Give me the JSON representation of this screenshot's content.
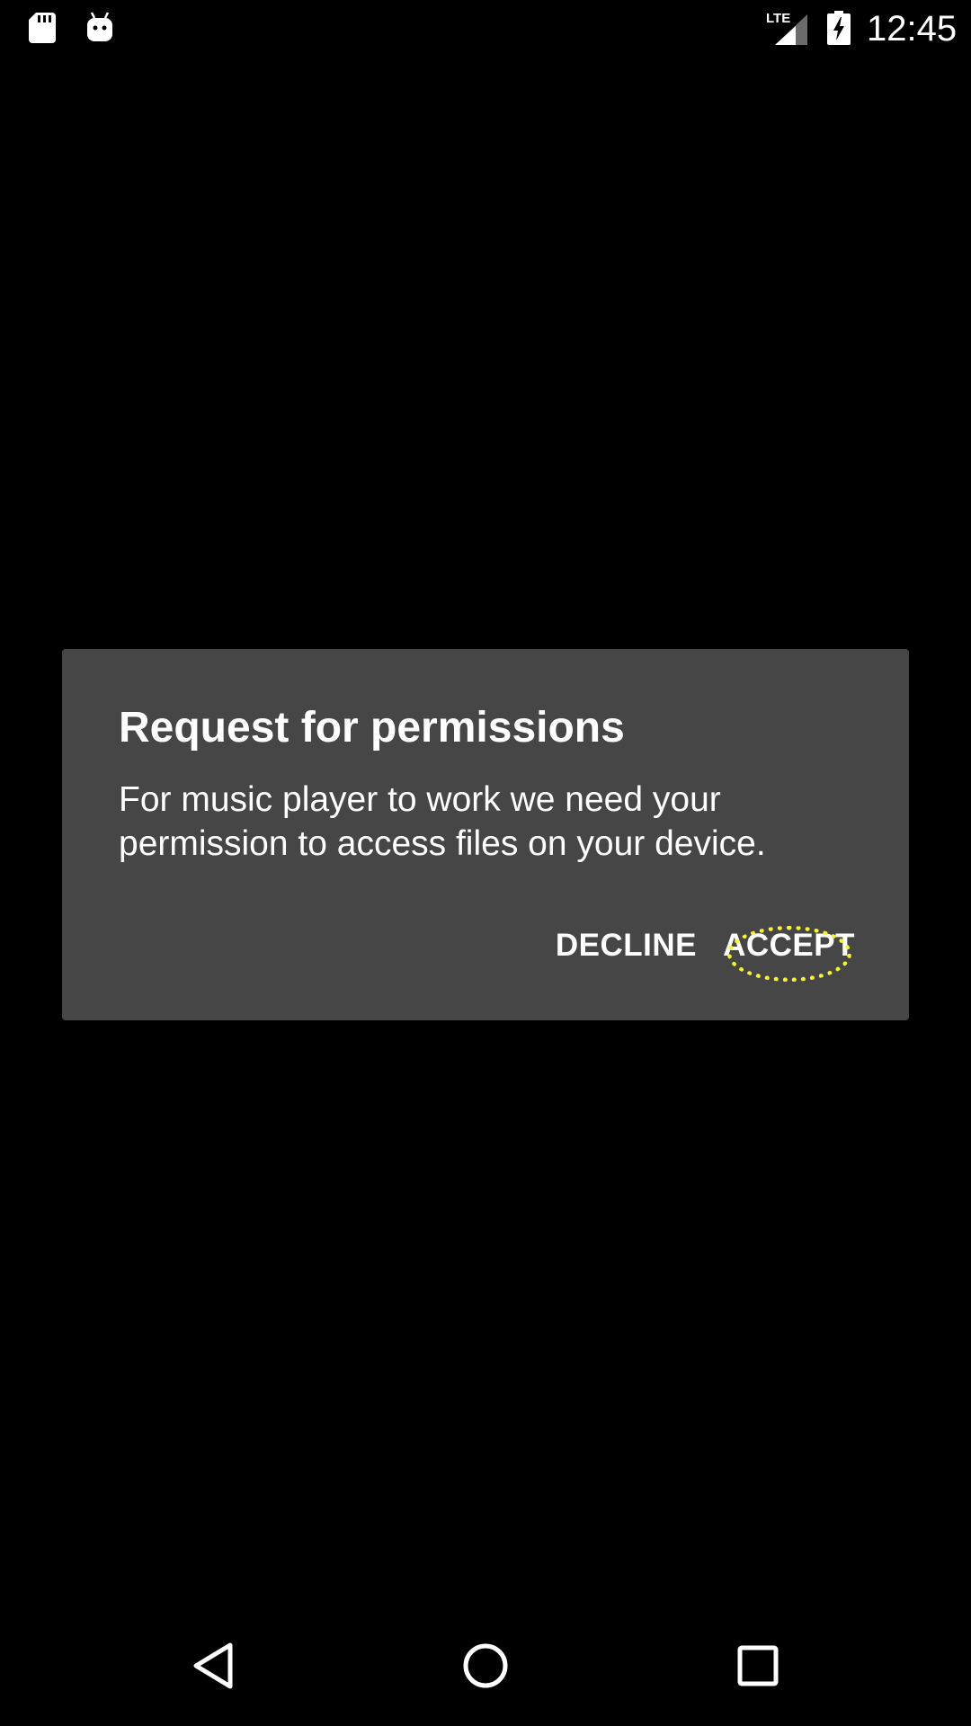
{
  "status_bar": {
    "left_icons": [
      "sd-card-icon",
      "android-debug-icon"
    ],
    "network_label": "LTE",
    "right_icons": [
      "lte-signal-icon",
      "battery-charging-icon"
    ],
    "time": "12:45"
  },
  "dialog": {
    "title": "Request for permissions",
    "message": "For music player to work we need your permission to access files on your device.",
    "decline_label": "DECLINE",
    "accept_label": "ACCEPT"
  },
  "nav_bar": {
    "icons": [
      "back-icon",
      "home-icon",
      "recents-icon"
    ]
  },
  "colors": {
    "background": "#000000",
    "dialog_background": "#464646",
    "text": "#ffffff",
    "focus_highlight": "#f5f52a"
  }
}
